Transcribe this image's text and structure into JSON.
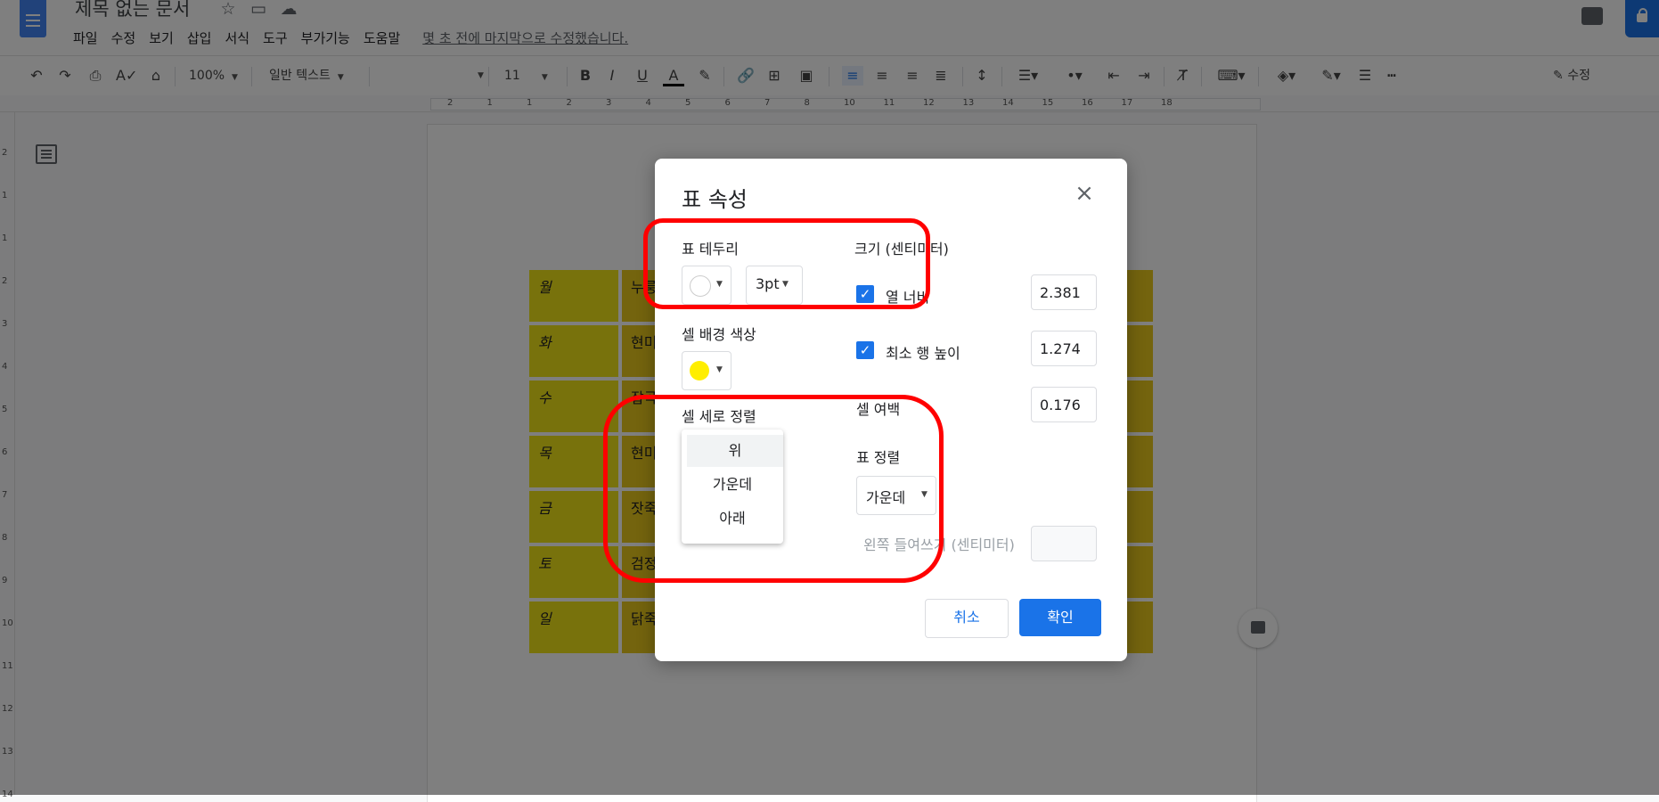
{
  "header": {
    "title": "제목 없는 문서",
    "menu": [
      "파일",
      "수정",
      "보기",
      "삽입",
      "서식",
      "도구",
      "부가기능",
      "도움말"
    ],
    "last_edit": "몇 초 전에 마지막으로 수정했습니다."
  },
  "toolbar": {
    "zoom": "100%",
    "style": "일반 텍스트",
    "font_size": "11",
    "edit_mode": "수정",
    "bold": "B",
    "italic": "I",
    "underline": "U",
    "text_color": "A"
  },
  "ruler": {
    "marks": [
      "2",
      "1",
      "1",
      "2",
      "3",
      "4",
      "5",
      "6",
      "7",
      "8",
      "10",
      "11",
      "12",
      "13",
      "14",
      "15",
      "16",
      "17",
      "18"
    ],
    "left_marks": [
      "2",
      "1",
      "1",
      "2",
      "3",
      "4",
      "5",
      "6",
      "7",
      "8",
      "9",
      "10",
      "11",
      "12",
      "13",
      "14"
    ]
  },
  "table": {
    "rows": [
      {
        "day": "월",
        "food": "누룽"
      },
      {
        "day": "화",
        "food": "현미"
      },
      {
        "day": "수",
        "food": "잡곡"
      },
      {
        "day": "목",
        "food": "현미"
      },
      {
        "day": "금",
        "food": "잣죽"
      },
      {
        "day": "토",
        "food": "검정"
      },
      {
        "day": "일",
        "food": "닭죽"
      }
    ]
  },
  "dialog": {
    "title": "표 속성",
    "border_label": "표 테두리",
    "border_width": "3pt",
    "bg_label": "셀 배경 색상",
    "valign_label": "셀 세로 정렬",
    "valign_options": [
      "위",
      "가운데",
      "아래"
    ],
    "size_label": "크기 (센티미터)",
    "col_width_label": "열 너비",
    "col_width_value": "2.381",
    "row_height_label": "최소 행 높이",
    "row_height_value": "1.274",
    "padding_label": "셀 여백",
    "padding_value": "0.176",
    "table_align_label": "표 정렬",
    "table_align_value": "가운데",
    "indent_label": "왼쪽 들여쓰기 (센티미터)",
    "cancel": "취소",
    "ok": "확인"
  },
  "colors": {
    "accent": "#1a73e8",
    "annotation": "#ff0000",
    "cell_bg": "#f1e418",
    "swatch_border": "#ffffff",
    "swatch_bg": "#ffee00"
  }
}
